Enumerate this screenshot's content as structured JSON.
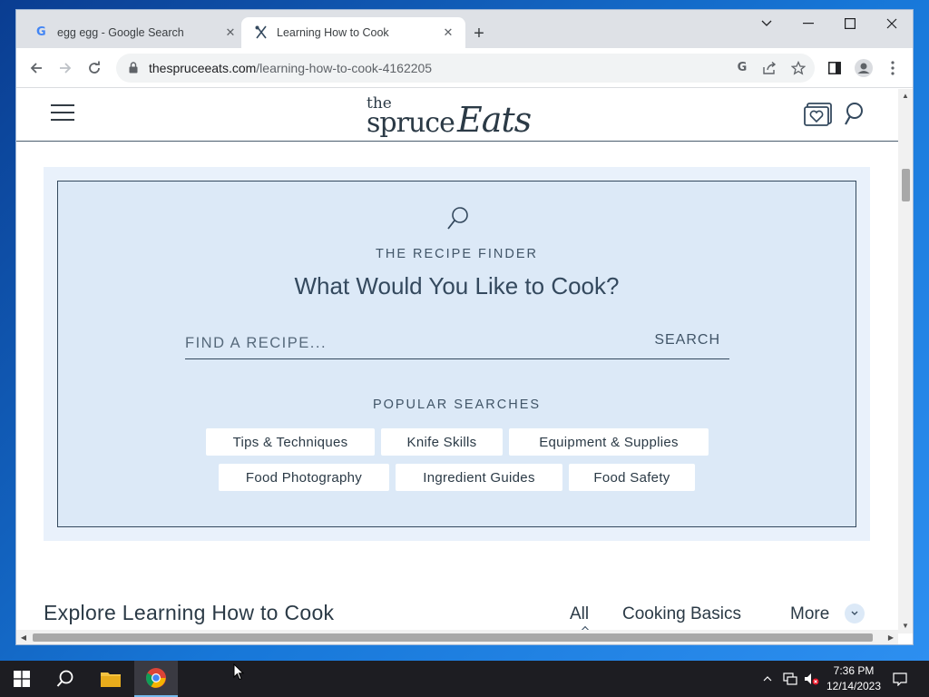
{
  "browser": {
    "tabs": [
      {
        "title": "egg egg - Google Search",
        "icon": "google-icon",
        "active": false
      },
      {
        "title": "Learning How to Cook",
        "icon": "spoon-fork-icon",
        "active": true
      }
    ],
    "new_tab": "+",
    "address": {
      "host": "thespruceeats.com",
      "path": "/learning-how-to-cook-4162205"
    }
  },
  "site": {
    "logo": {
      "the": "the",
      "spruce": "spruce",
      "eats": "Eats"
    },
    "finder": {
      "kicker": "THE RECIPE FINDER",
      "title": "What Would You Like to Cook?",
      "search_placeholder": "FIND A RECIPE...",
      "search_button": "SEARCH",
      "popular_label": "POPULAR SEARCHES",
      "chips": [
        "Tips & Techniques",
        "Knife Skills",
        "Equipment & Supplies",
        "Food Photography",
        "Ingredient Guides",
        "Food Safety"
      ]
    },
    "explore": {
      "title": "Explore Learning How to Cook",
      "tabs": [
        "All",
        "Cooking Basics",
        "More"
      ]
    }
  },
  "taskbar": {
    "time": "7:36 PM",
    "date": "12/14/2023"
  },
  "colors": {
    "finder_bg": "#dce9f7",
    "text_dark": "#2b3a46",
    "accent_blue": "#1a73e8"
  }
}
